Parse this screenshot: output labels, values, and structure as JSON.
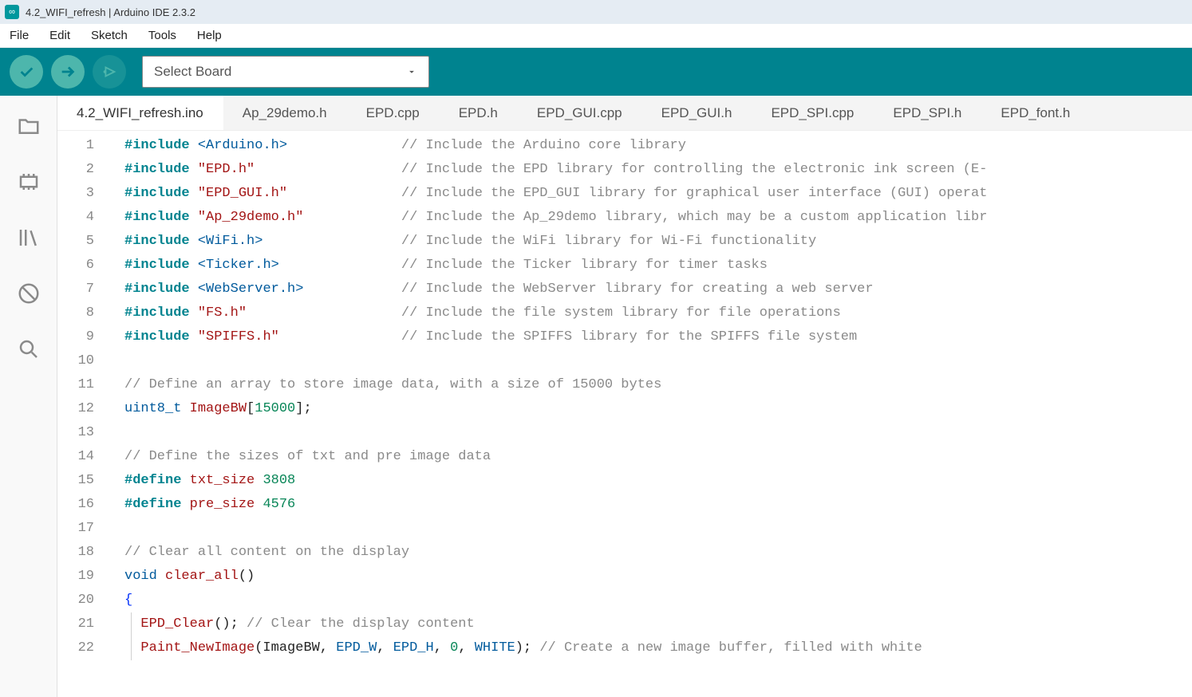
{
  "window": {
    "title": "4.2_WIFI_refresh | Arduino IDE 2.3.2"
  },
  "menu": {
    "items": [
      "File",
      "Edit",
      "Sketch",
      "Tools",
      "Help"
    ]
  },
  "toolbar": {
    "board_placeholder": "Select Board"
  },
  "tabs": [
    "4.2_WIFI_refresh.ino",
    "Ap_29demo.h",
    "EPD.cpp",
    "EPD.h",
    "EPD_GUI.cpp",
    "EPD_GUI.h",
    "EPD_SPI.cpp",
    "EPD_SPI.h",
    "EPD_font.h"
  ],
  "code": {
    "lines": [
      {
        "n": 1,
        "seg": [
          [
            "kw",
            "#include"
          ],
          [
            "",
            " "
          ],
          [
            "ang",
            "<Arduino.h>"
          ],
          [
            "pad",
            "              "
          ],
          [
            "cmt",
            "// Include the Arduino core library"
          ]
        ]
      },
      {
        "n": 2,
        "seg": [
          [
            "kw",
            "#include"
          ],
          [
            "",
            " "
          ],
          [
            "str",
            "\"EPD.h\""
          ],
          [
            "pad",
            "                  "
          ],
          [
            "cmt",
            "// Include the EPD library for controlling the electronic ink screen (E-"
          ]
        ]
      },
      {
        "n": 3,
        "seg": [
          [
            "kw",
            "#include"
          ],
          [
            "",
            " "
          ],
          [
            "str",
            "\"EPD_GUI.h\""
          ],
          [
            "pad",
            "              "
          ],
          [
            "cmt",
            "// Include the EPD_GUI library for graphical user interface (GUI) operat"
          ]
        ]
      },
      {
        "n": 4,
        "seg": [
          [
            "kw",
            "#include"
          ],
          [
            "",
            " "
          ],
          [
            "str",
            "\"Ap_29demo.h\""
          ],
          [
            "pad",
            "            "
          ],
          [
            "cmt",
            "// Include the Ap_29demo library, which may be a custom application libr"
          ]
        ]
      },
      {
        "n": 5,
        "seg": [
          [
            "kw",
            "#include"
          ],
          [
            "",
            " "
          ],
          [
            "ang",
            "<WiFi.h>"
          ],
          [
            "pad",
            "                 "
          ],
          [
            "cmt",
            "// Include the WiFi library for Wi-Fi functionality"
          ]
        ]
      },
      {
        "n": 6,
        "seg": [
          [
            "kw",
            "#include"
          ],
          [
            "",
            " "
          ],
          [
            "ang",
            "<Ticker.h>"
          ],
          [
            "pad",
            "               "
          ],
          [
            "cmt",
            "// Include the Ticker library for timer tasks"
          ]
        ]
      },
      {
        "n": 7,
        "seg": [
          [
            "kw",
            "#include"
          ],
          [
            "",
            " "
          ],
          [
            "ang",
            "<WebServer.h>"
          ],
          [
            "pad",
            "            "
          ],
          [
            "cmt",
            "// Include the WebServer library for creating a web server"
          ]
        ]
      },
      {
        "n": 8,
        "seg": [
          [
            "kw",
            "#include"
          ],
          [
            "",
            " "
          ],
          [
            "str",
            "\"FS.h\""
          ],
          [
            "pad",
            "                   "
          ],
          [
            "cmt",
            "// Include the file system library for file operations"
          ]
        ]
      },
      {
        "n": 9,
        "seg": [
          [
            "kw",
            "#include"
          ],
          [
            "",
            " "
          ],
          [
            "str",
            "\"SPIFFS.h\""
          ],
          [
            "pad",
            "               "
          ],
          [
            "cmt",
            "// Include the SPIFFS library for the SPIFFS file system"
          ]
        ]
      },
      {
        "n": 10,
        "seg": []
      },
      {
        "n": 11,
        "seg": [
          [
            "cmt",
            "// Define an array to store image data, with a size of 15000 bytes"
          ]
        ]
      },
      {
        "n": 12,
        "seg": [
          [
            "typ",
            "uint8_t"
          ],
          [
            "",
            " "
          ],
          [
            "def",
            "ImageBW"
          ],
          [
            "",
            "["
          ],
          [
            "num",
            "15000"
          ],
          [
            "",
            "];"
          ]
        ]
      },
      {
        "n": 13,
        "seg": []
      },
      {
        "n": 14,
        "seg": [
          [
            "cmt",
            "// Define the sizes of txt and pre image data"
          ]
        ]
      },
      {
        "n": 15,
        "seg": [
          [
            "kw",
            "#define"
          ],
          [
            "",
            " "
          ],
          [
            "def",
            "txt_size"
          ],
          [
            "",
            " "
          ],
          [
            "num",
            "3808"
          ]
        ]
      },
      {
        "n": 16,
        "seg": [
          [
            "kw",
            "#define"
          ],
          [
            "",
            " "
          ],
          [
            "def",
            "pre_size"
          ],
          [
            "",
            " "
          ],
          [
            "num",
            "4576"
          ]
        ]
      },
      {
        "n": 17,
        "seg": []
      },
      {
        "n": 18,
        "seg": [
          [
            "cmt",
            "// Clear all content on the display"
          ]
        ]
      },
      {
        "n": 19,
        "seg": [
          [
            "typ",
            "void"
          ],
          [
            "",
            " "
          ],
          [
            "fn",
            "clear_all"
          ],
          [
            "",
            "()"
          ]
        ]
      },
      {
        "n": 20,
        "seg": [
          [
            "brace",
            "{"
          ]
        ]
      },
      {
        "n": 21,
        "seg": [
          [
            "",
            "  "
          ],
          [
            "fn",
            "EPD_Clear"
          ],
          [
            "",
            "(); "
          ],
          [
            "cmt",
            "// Clear the display content"
          ]
        ],
        "guide": true
      },
      {
        "n": 22,
        "seg": [
          [
            "",
            "  "
          ],
          [
            "fn",
            "Paint_NewImage"
          ],
          [
            "",
            "(ImageBW, "
          ],
          [
            "const",
            "EPD_W"
          ],
          [
            "",
            ", "
          ],
          [
            "const",
            "EPD_H"
          ],
          [
            "",
            ", "
          ],
          [
            "num",
            "0"
          ],
          [
            "",
            ", "
          ],
          [
            "const",
            "WHITE"
          ],
          [
            "",
            "); "
          ],
          [
            "cmt",
            "// Create a new image buffer, filled with white"
          ]
        ],
        "guide": true
      }
    ]
  }
}
